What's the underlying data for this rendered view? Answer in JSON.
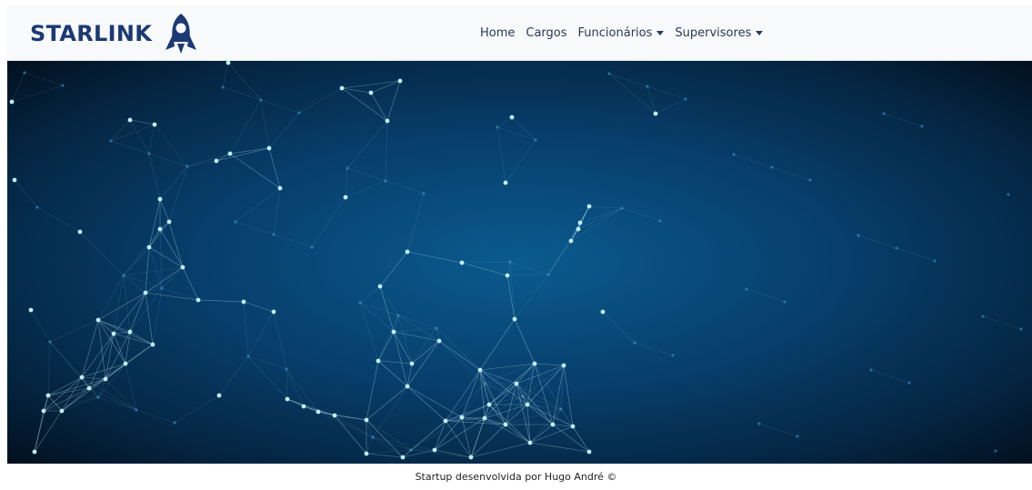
{
  "brand": {
    "name": "STARLINK",
    "logo_icon": "rocket-icon",
    "color": "#1b3a73"
  },
  "nav": {
    "items": [
      {
        "label": "Home",
        "dropdown": false
      },
      {
        "label": "Cargos",
        "dropdown": false
      },
      {
        "label": "Funcionários",
        "dropdown": true
      },
      {
        "label": "Supervisores",
        "dropdown": true
      }
    ]
  },
  "hero": {
    "image": "network-constellation-background",
    "colors": [
      "#0b5a8e",
      "#042440",
      "#02101f"
    ],
    "accent": "#bfeef5"
  },
  "footer": {
    "text": "Startup desenvolvida por Hugo André ©"
  }
}
